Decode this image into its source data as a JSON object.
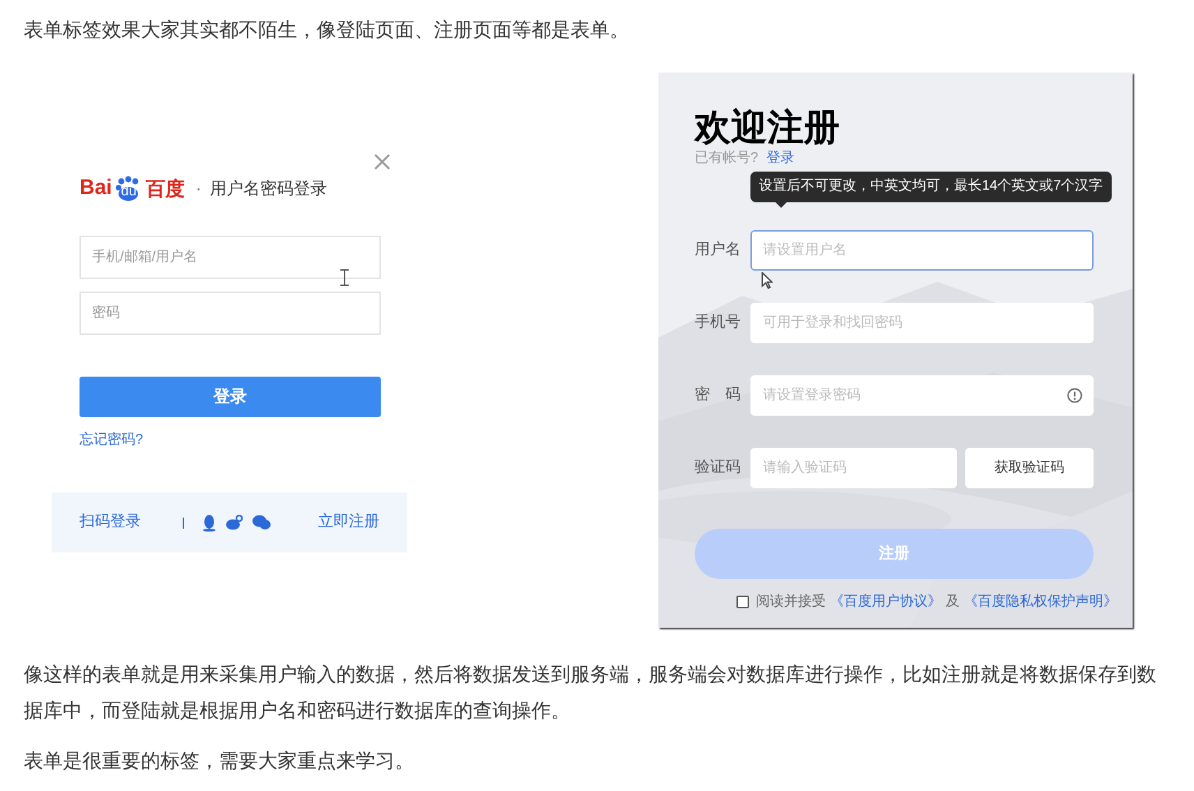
{
  "intro": "表单标签效果大家其实都不陌生，像登陆页面、注册页面等都是表单。",
  "login": {
    "brand_latin": "Bai",
    "brand_paw": "du",
    "brand_chinese": "百度",
    "separator": "·",
    "subtitle": "用户名密码登录",
    "fields": [
      {
        "placeholder": "手机/邮箱/用户名"
      },
      {
        "placeholder": "密码"
      }
    ],
    "submit": "登录",
    "forgot": "忘记密码?",
    "qr_login": "扫码登录",
    "register_link": "立即注册"
  },
  "register": {
    "title": "欢迎注册",
    "have_account": "已有帐号?",
    "login_link": "登录",
    "tooltip": "设置后不可更改，中英文均可，最长14个英文或7个汉字",
    "rows": [
      {
        "kind": "text",
        "label": "用户名",
        "placeholder": "请设置用户名",
        "focused": true
      },
      {
        "kind": "text",
        "label": "手机号",
        "placeholder": "可用于登录和找回密码",
        "focused": false
      },
      {
        "kind": "password",
        "label": "密　码",
        "placeholder": "请设置登录密码",
        "focused": false
      },
      {
        "kind": "code",
        "label": "验证码",
        "placeholder": "请输入验证码",
        "focused": false,
        "button": "获取验证码"
      }
    ],
    "submit": "注册",
    "agreement": {
      "checked": false,
      "text": "阅读并接受",
      "link_1": "《百度用户协议》",
      "conjunction": "及",
      "link_2": "《百度隐私权保护声明》"
    }
  },
  "paragraphs": [
    "像这样的表单就是用来采集用户输入的数据，然后将数据发送到服务端，服务端会对数据库进行操作，比如注册就是将数据保存到数据库中，而登陆就是根据用户名和密码进行数据库的查询操作。",
    "表单是很重要的标签，需要大家重点来学习。"
  ]
}
